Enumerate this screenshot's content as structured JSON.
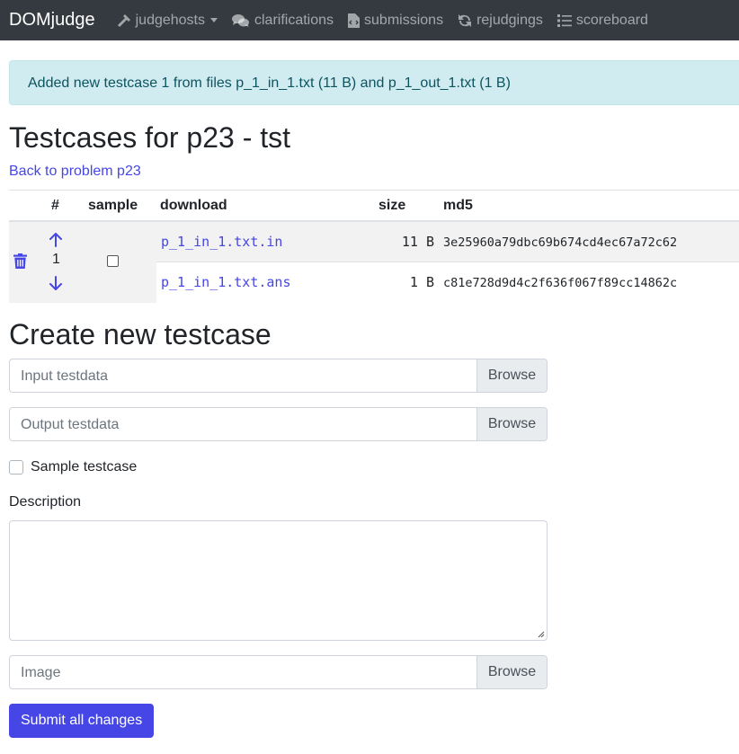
{
  "navbar": {
    "brand": "DOMjudge",
    "items": [
      {
        "label": "judgehosts",
        "icon": "hammer-icon",
        "dropdown": true
      },
      {
        "label": "clarifications",
        "icon": "comments-icon"
      },
      {
        "label": "submissions",
        "icon": "file-code-icon"
      },
      {
        "label": "rejudgings",
        "icon": "sync-icon"
      },
      {
        "label": "scoreboard",
        "icon": "list-ol-icon"
      }
    ]
  },
  "alert": {
    "text": "Added new testcase 1 from files p_1_in_1.txt (11 B) and p_1_out_1.txt (1 B)"
  },
  "page": {
    "title": "Testcases for p23 - tst",
    "back_link": "Back to problem p23"
  },
  "table": {
    "headers": {
      "num": "#",
      "sample": "sample",
      "download": "download",
      "size": "size",
      "md5": "md5"
    },
    "testcase": {
      "number": "1",
      "sample_checked": false,
      "files": [
        {
          "name": "p_1_in_1.txt.in",
          "size": "11 B",
          "md5": "3e25960a79dbc69b674cd4ec67a72c62"
        },
        {
          "name": "p_1_in_1.txt.ans",
          "size": "1 B",
          "md5": "c81e728d9d4c2f636f067f89cc14862c"
        }
      ]
    }
  },
  "form": {
    "title": "Create new testcase",
    "input_placeholder": "Input testdata",
    "output_placeholder": "Output testdata",
    "browse_label": "Browse",
    "sample_label": "Sample testcase",
    "description_label": "Description",
    "image_placeholder": "Image",
    "submit_label": "Submit all changes"
  },
  "colors": {
    "navbar": "#343a40",
    "link": "#4646e6",
    "alert_bg": "#d1ecf1",
    "alert_text": "#0c5460",
    "primary": "#4646e6"
  }
}
